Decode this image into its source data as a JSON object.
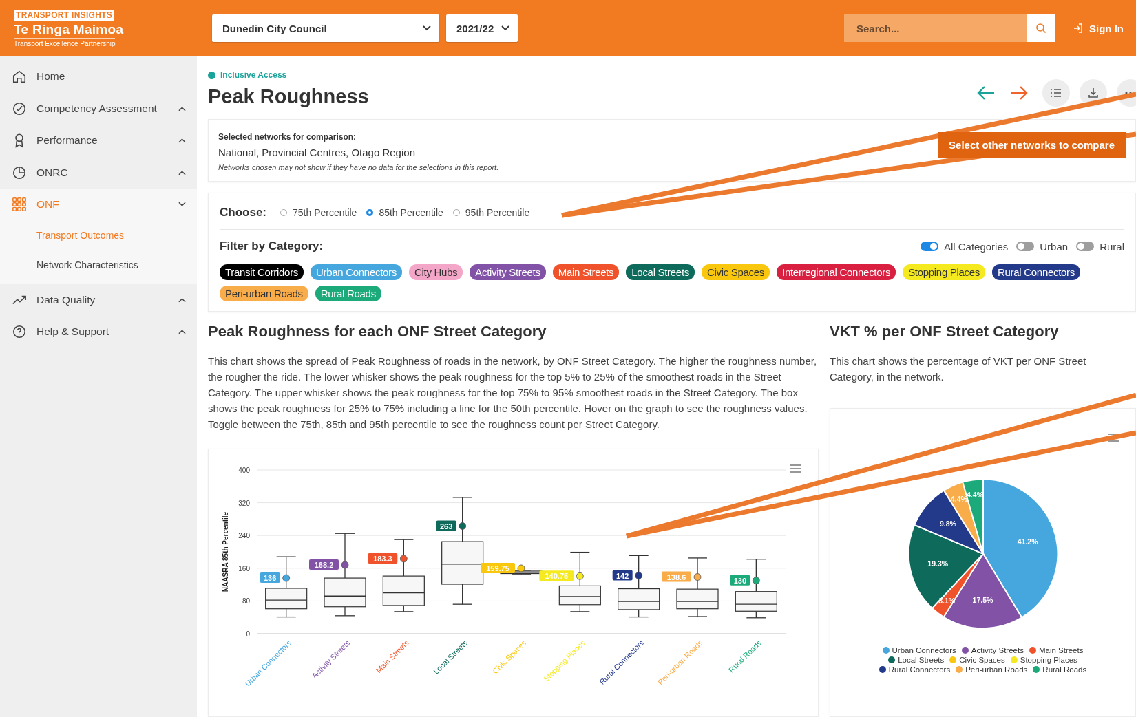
{
  "header": {
    "brand_tag": "TRANSPORT INSIGHTS",
    "brand_name": "Te Ringa Maimoa",
    "brand_sub": "Transport Excellence Partnership",
    "council": "Dunedin City Council",
    "year": "2021/22",
    "search": {
      "placeholder": "Search..."
    },
    "sign_in": "Sign In"
  },
  "sidebar": {
    "items": [
      {
        "kind": "link",
        "label": "Home",
        "selected": false
      },
      {
        "kind": "group",
        "label": "Competency Assessment",
        "expanded": false,
        "selected": false
      },
      {
        "kind": "group",
        "label": "Performance",
        "expanded": false,
        "selected": false
      },
      {
        "kind": "group",
        "label": "ONRC",
        "expanded": false,
        "selected": false
      },
      {
        "kind": "group",
        "label": "ONF",
        "expanded": true,
        "selected": true,
        "children": [
          {
            "label": "Transport Outcomes",
            "selected": true
          },
          {
            "label": "Network Characteristics",
            "selected": false
          }
        ]
      },
      {
        "kind": "group",
        "label": "Data Quality",
        "expanded": false,
        "selected": false
      },
      {
        "kind": "group",
        "label": "Help & Support",
        "expanded": false,
        "selected": false
      }
    ]
  },
  "page": {
    "breadcrumb": "Inclusive Access",
    "title": "Peak Roughness"
  },
  "networks": {
    "label": "Selected networks for comparison:",
    "value": "National, Provincial Centres, Otago Region",
    "note": "Networks chosen may not show if they have no data for the selections in this report.",
    "button": "Select other networks to compare"
  },
  "choose": {
    "label": "Choose:",
    "options": [
      {
        "label": "75th Percentile",
        "selected": false
      },
      {
        "label": "85th Percentile",
        "selected": true
      },
      {
        "label": "95th Percentile",
        "selected": false
      }
    ]
  },
  "filter": {
    "label": "Filter by Category:",
    "toggles": [
      {
        "label": "All Categories",
        "on": true
      },
      {
        "label": "Urban",
        "on": false
      },
      {
        "label": "Rural",
        "on": false
      }
    ],
    "tags": [
      {
        "label": "Transit Corridors",
        "color": "#000000"
      },
      {
        "label": "Urban Connectors",
        "color": "#45a7de"
      },
      {
        "label": "City Hubs",
        "color": "#f4a6c8"
      },
      {
        "label": "Activity Streets",
        "color": "#8152a6"
      },
      {
        "label": "Main Streets",
        "color": "#f0532b"
      },
      {
        "label": "Local Streets",
        "color": "#0e6b5b"
      },
      {
        "label": "Civic Spaces",
        "color": "#f9c80e"
      },
      {
        "label": "Interregional Connectors",
        "color": "#d92040"
      },
      {
        "label": "Stopping Places",
        "color": "#f5ea20"
      },
      {
        "label": "Rural Connectors",
        "color": "#233a8b"
      },
      {
        "label": "Peri-urban Roads",
        "color": "#f9ac4a"
      },
      {
        "label": "Rural Roads",
        "color": "#1daa7b"
      }
    ]
  },
  "roughness": {
    "heading": "Peak Roughness for each ONF Street Category",
    "description": "This chart shows the spread of Peak Roughness of roads in the network, by ONF Street Category. The higher the roughness number, the rougher the ride. The lower whisker shows the peak roughness for the top 5% to 25% of the smoothest roads in the Street Category. The upper whisker shows the peak roughness for the top 75% to 95% smoothest roads in the Street Category. The box shows the peak roughness for 25% to 75% including a line for the 50th percentile. Hover on the graph to see the roughness values. Toggle between the 75th, 85th and 95th percentile to see the roughness count per Street Category.",
    "chart_data": {
      "type": "scatter",
      "ylabel": "NAASRA 85th Percentile",
      "categories": [
        "Urban Connectors",
        "Activity Streets",
        "Main Streets",
        "Local Streets",
        "Civic Spaces",
        "Stopping Places",
        "Rural Connectors",
        "Peri-urban Roads",
        "Rural Roads"
      ],
      "colors": [
        "#45a7de",
        "#8152a6",
        "#f0532b",
        "#0e6b5b",
        "#f9c80e",
        "#f5ea20",
        "#233a8b",
        "#f9ac4a",
        "#1daa7b"
      ],
      "ylim": [
        0,
        400
      ],
      "yticks": [
        0,
        80,
        160,
        240,
        320,
        400
      ],
      "grid": true,
      "data_labels": true,
      "series": [
        {
          "colors": [
            "#45a7de",
            "#8152a6",
            "#f0532b",
            "#0e6b5b",
            "#f9c80e",
            "#f5ea20",
            "#233a8b",
            "#f9ac4a",
            "#1daa7b"
          ],
          "values": [
            136,
            168.2,
            183.3,
            263,
            159.75,
            140.75,
            142,
            138.6,
            130
          ]
        }
      ]
    }
  },
  "vkt": {
    "heading": "VKT % per ONF Street Category",
    "description": "This chart shows the percentage of VKT per ONF Street Category, in the network.",
    "chart_data": {
      "type": "pie",
      "categories": [
        "Urban Connectors",
        "Activity Streets",
        "Main Streets",
        "Local Streets",
        "Civic Spaces",
        "Stopping Places",
        "Rural Connectors",
        "Peri-urban Roads",
        "Rural Roads"
      ],
      "colors": [
        "#45a7de",
        "#8152a6",
        "#f0532b",
        "#0e6b5b",
        "#f9c80e",
        "#f5ea20",
        "#233a8b",
        "#f9ac4a",
        "#1daa7b"
      ],
      "values": [
        41.2,
        17.5,
        3.1,
        19.3,
        0,
        0,
        9.8,
        4.4,
        4.4
      ],
      "value_labels": [
        "41.2%",
        "17.5%",
        "3.1%",
        "19.3%",
        null,
        null,
        "9.8%",
        "4.4%",
        "4.4%"
      ],
      "legend": "bottom"
    }
  }
}
